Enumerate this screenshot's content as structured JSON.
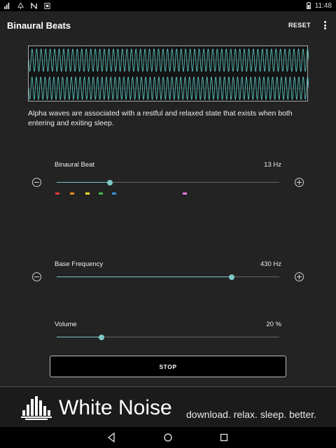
{
  "status_bar": {
    "time": "11:48",
    "left_icons": [
      "signal-bars-icon",
      "tree-icon",
      "n-logo-icon",
      "box-icon"
    ],
    "right_icons": [
      "battery-icon"
    ]
  },
  "app_bar": {
    "title": "Binaural Beats",
    "reset_label": "RESET",
    "overflow_icon": "more-vert-icon"
  },
  "waveform": {
    "color": "#58c0bb",
    "channels": 2
  },
  "description": "Alpha waves are associated with a restful and relaxed state that exists when both entering and exiting sleep.",
  "binaural_beat": {
    "label": "Binaural Beat",
    "value": "13 Hz",
    "slider_fraction": 0.24,
    "presets": [
      {
        "color": "#e53935",
        "fraction": 0.0
      },
      {
        "color": "#ef8a1f",
        "fraction": 0.067
      },
      {
        "color": "#f2dc2a",
        "fraction": 0.133
      },
      {
        "color": "#43c04a",
        "fraction": 0.195
      },
      {
        "color": "#3a8fde",
        "fraction": 0.253
      },
      {
        "color": "#e77ad6",
        "fraction": 0.57
      }
    ]
  },
  "base_frequency": {
    "label": "Base Frequency",
    "value": "430 Hz",
    "slider_fraction": 0.787
  },
  "volume": {
    "label": "Volume",
    "value": "20 %",
    "slider_fraction": 0.2
  },
  "stop_label": "STOP",
  "ad": {
    "title": "White Noise",
    "tagline": "download. relax. sleep. better."
  },
  "nav": {
    "back_icon": "back-triangle-icon",
    "home_icon": "home-circle-icon",
    "recents_icon": "recents-square-icon"
  },
  "colors": {
    "accent": "#7ec8c6",
    "background": "#232323",
    "app_bar": "#222222"
  }
}
